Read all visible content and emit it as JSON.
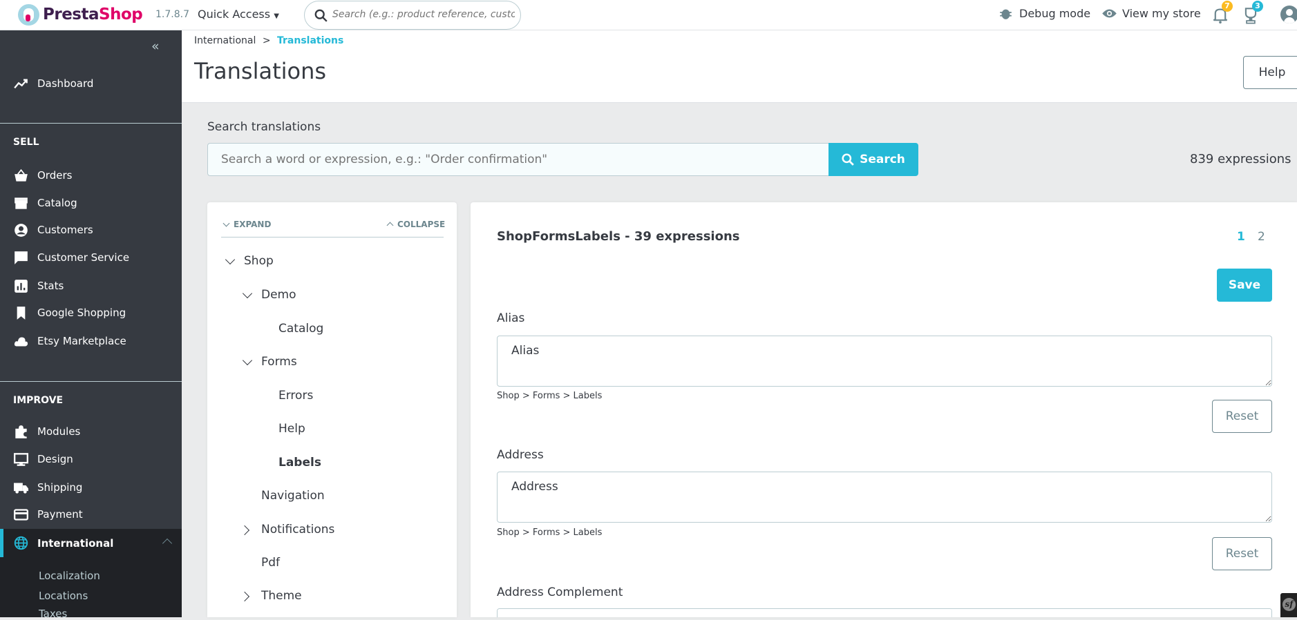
{
  "header": {
    "brand": "PrestaShop",
    "brand_a": "Presta",
    "brand_b": "Shop",
    "version": "1.7.8.7",
    "quick_access": "Quick Access",
    "search_placeholder": "Search (e.g.: product reference, custon",
    "debug_mode": "Debug mode",
    "view_store": "View my store",
    "notifications_count": "7",
    "trophy_count": "3"
  },
  "sidebar": {
    "dashboard": "Dashboard",
    "sell_title": "SELL",
    "sell_items": [
      "Orders",
      "Catalog",
      "Customers",
      "Customer Service",
      "Stats",
      "Google Shopping",
      "Etsy Marketplace"
    ],
    "improve_title": "IMPROVE",
    "improve_items": [
      "Modules",
      "Design",
      "Shipping",
      "Payment",
      "International"
    ],
    "international_sub": [
      "Localization",
      "Locations",
      "Taxes"
    ]
  },
  "page": {
    "breadcrumb_parent": "International",
    "breadcrumb_sep": ">",
    "breadcrumb_current": "Translations",
    "title": "Translations",
    "help": "Help"
  },
  "search": {
    "label": "Search translations",
    "placeholder": "Search a word or expression, e.g.: \"Order confirmation\"",
    "button": "Search",
    "count": "839 expressions"
  },
  "tree": {
    "expand": "EXPAND",
    "collapse": "COLLAPSE",
    "items": [
      "Shop",
      "Demo",
      "Catalog",
      "Forms",
      "Errors",
      "Help",
      "Labels",
      "Navigation",
      "Notifications",
      "Pdf",
      "Theme"
    ]
  },
  "panel": {
    "title": "ShopFormsLabels - 39 expressions",
    "pages": [
      "1",
      "2"
    ],
    "save": "Save",
    "reset": "Reset",
    "fields": [
      {
        "label": "Alias",
        "value": "Alias",
        "path": "Shop > Forms > Labels"
      },
      {
        "label": "Address",
        "value": "Address",
        "path": "Shop > Forms > Labels"
      },
      {
        "label": "Address Complement",
        "value": "",
        "path": ""
      }
    ]
  },
  "colors": {
    "accent": "#25b9d7",
    "sidebar": "#363a41",
    "sidebar_active": "#202226",
    "badge_orange": "#fbbb22"
  }
}
